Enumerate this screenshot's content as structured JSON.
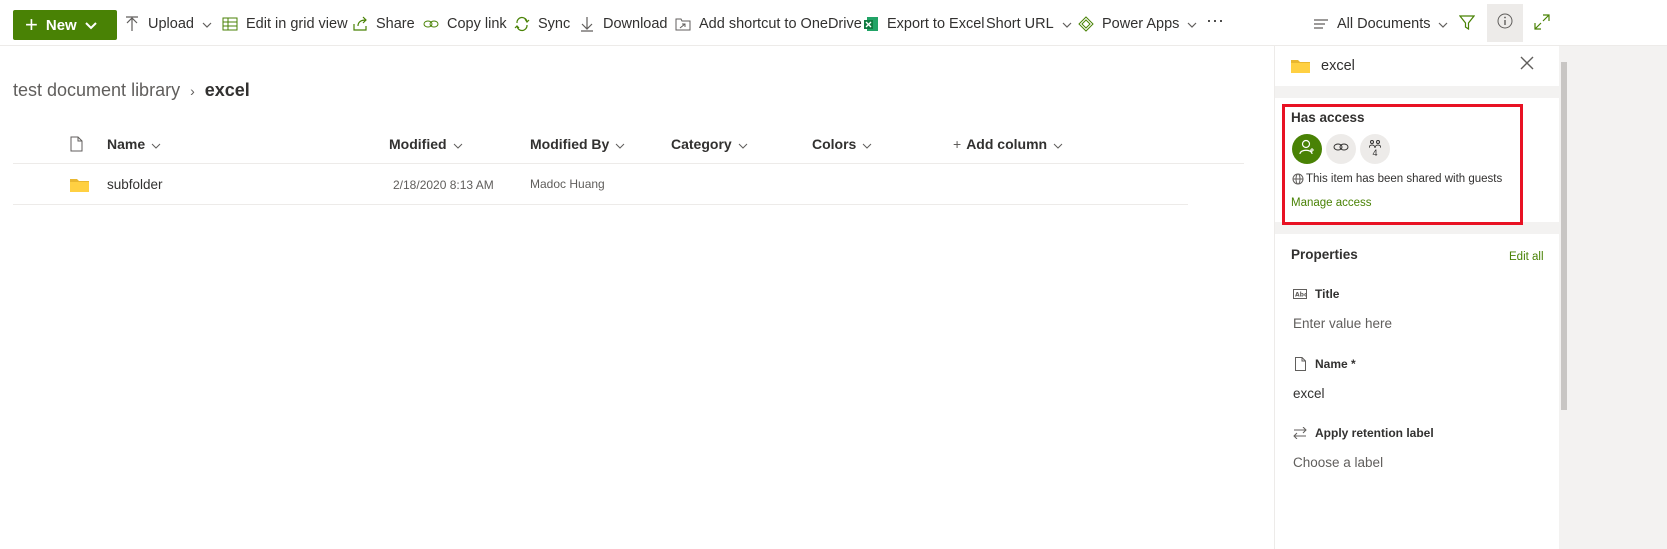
{
  "toolbar": {
    "new_label": "New",
    "upload": "Upload",
    "edit_grid": "Edit in grid view",
    "share": "Share",
    "copy_link": "Copy link",
    "sync": "Sync",
    "download": "Download",
    "add_shortcut": "Add shortcut to OneDrive",
    "export_excel": "Export to Excel",
    "short_url": "Short URL",
    "power_apps": "Power Apps",
    "more": "···",
    "view": "All Documents"
  },
  "breadcrumb": {
    "parent": "test document library",
    "separator": "›",
    "current": "excel"
  },
  "columns": {
    "name": "Name",
    "modified": "Modified",
    "modified_by": "Modified By",
    "category": "Category",
    "colors": "Colors",
    "add_column": "Add column"
  },
  "rows": [
    {
      "name": "subfolder",
      "modified": "2/18/2020 8:13 AM",
      "modified_by": "Madoc Huang"
    }
  ],
  "panel": {
    "title": "excel",
    "has_access": "Has access",
    "people_count": "4",
    "guest_notice": "This item has been shared with guests",
    "manage_access": "Manage access",
    "properties": "Properties",
    "edit_all": "Edit all",
    "fields": [
      {
        "label": "Title",
        "value": "Enter value here",
        "placeholder": true
      },
      {
        "label": "Name *",
        "value": "excel",
        "placeholder": false
      },
      {
        "label": "Apply retention label",
        "value": "Choose a label",
        "placeholder": true
      }
    ]
  },
  "colors": {
    "accent": "#498205",
    "highlight": "#e81123",
    "folder": "#ffd042"
  }
}
